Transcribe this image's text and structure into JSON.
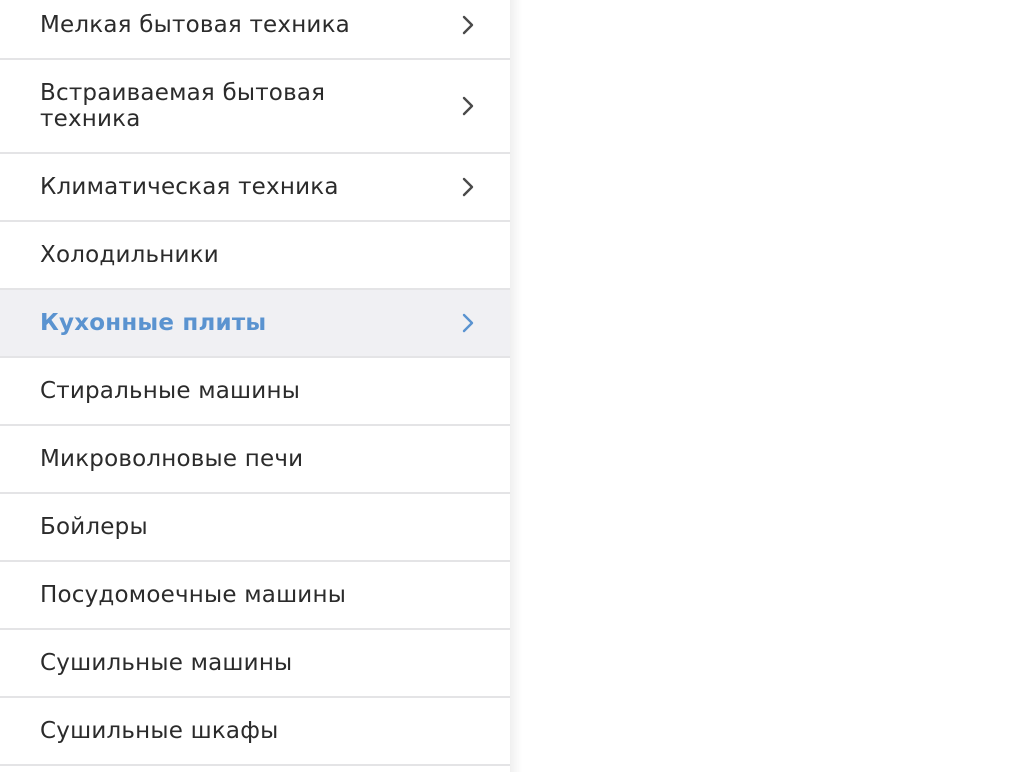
{
  "menu": {
    "items": [
      {
        "label": "Мелкая бытовая техника",
        "has_submenu": true,
        "active": false
      },
      {
        "label": "Встраиваемая бытовая техника",
        "has_submenu": true,
        "active": false
      },
      {
        "label": "Климатическая техника",
        "has_submenu": true,
        "active": false
      },
      {
        "label": "Холодильники",
        "has_submenu": false,
        "active": false
      },
      {
        "label": "Кухонные плиты",
        "has_submenu": true,
        "active": true
      },
      {
        "label": "Стиральные машины",
        "has_submenu": false,
        "active": false
      },
      {
        "label": "Микроволновые печи",
        "has_submenu": false,
        "active": false
      },
      {
        "label": "Бойлеры",
        "has_submenu": false,
        "active": false
      },
      {
        "label": "Посудомоечные машины",
        "has_submenu": false,
        "active": false
      },
      {
        "label": "Сушильные машины",
        "has_submenu": false,
        "active": false
      },
      {
        "label": "Сушильные шкафы",
        "has_submenu": false,
        "active": false
      }
    ]
  },
  "colors": {
    "text": "#2b2b2b",
    "active_text": "#5a93d0",
    "active_background": "#f0f0f3",
    "divider": "#e4e4e6",
    "chevron": "#4a4a4a"
  },
  "icons": {
    "submenu": "chevron-right-icon"
  }
}
